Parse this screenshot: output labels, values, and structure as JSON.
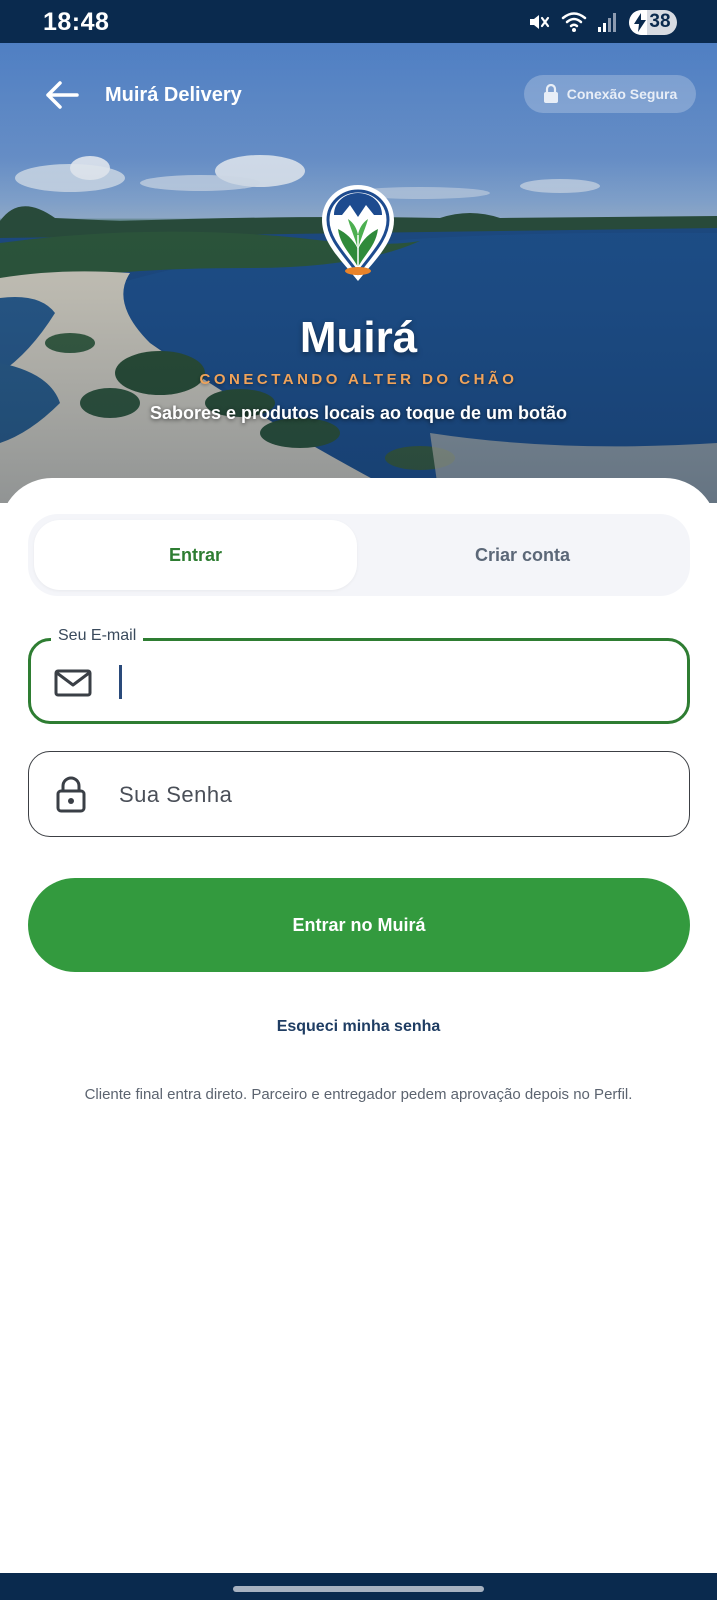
{
  "status_bar": {
    "time": "18:48",
    "battery_percent": 38,
    "battery_text": "38",
    "icons": [
      "mute-icon",
      "wifi-icon",
      "signal-icon",
      "battery-charging-icon"
    ]
  },
  "header": {
    "back_icon": "arrow-left-icon",
    "title": "Muirá Delivery",
    "secure_label": "Conexão Segura",
    "secure_icon": "lock-icon"
  },
  "hero": {
    "brand": "Muirá",
    "tagline": "CONECTANDO ALTER DO CHÃO",
    "subtitle": "Sabores e produtos locais ao toque de um botão"
  },
  "tabs": [
    {
      "label": "Entrar",
      "active": true
    },
    {
      "label": "Criar conta",
      "active": false
    }
  ],
  "form": {
    "email": {
      "label": "Seu E-mail",
      "value": "",
      "icon": "mail-icon"
    },
    "password": {
      "placeholder": "Sua Senha",
      "value": "",
      "icon": "lock-icon"
    },
    "submit_label": "Entrar no Muirá",
    "forgot_label": "Esqueci minha senha",
    "note": "Cliente final entra direto. Parceiro e entregador pedem aprovação depois no Perfil."
  },
  "colors": {
    "primary_green": "#339a3e",
    "active_tab_text": "#2e7d32",
    "navy": "#0a2a4e",
    "tagline_orange": "#f0a35a"
  }
}
